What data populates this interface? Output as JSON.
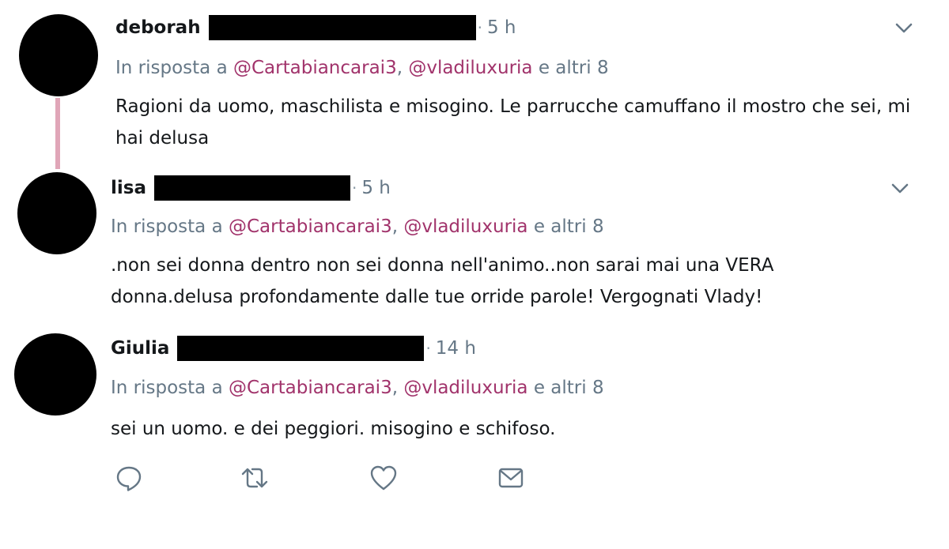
{
  "tweets": [
    {
      "username": "deborah",
      "time": "5 h",
      "reply_prefix": "In risposta a",
      "mention1": "@Cartabiancarai3",
      "separator": ",",
      "mention2": "@vladiluxuria",
      "reply_suffix": "e altri 8",
      "text": "Ragioni da uomo,  maschilista e misogino. Le parrucche camuffano il mostro che sei, mi hai delusa"
    },
    {
      "username": "lisa",
      "time": "5 h",
      "reply_prefix": "In risposta a",
      "mention1": "@Cartabiancarai3",
      "separator": ",",
      "mention2": "@vladiluxuria",
      "reply_suffix": "e altri 8",
      "text": ".non sei donna dentro non sei donna nell'animo..non sarai mai una VERA donna.delusa profondamente dalle tue orride parole! Vergognati Vlady!"
    },
    {
      "username": "Giulia",
      "time": "14 h",
      "reply_prefix": "In risposta a",
      "mention1": "@Cartabiancarai3",
      "separator": ",",
      "mention2": "@vladiluxuria",
      "reply_suffix": "e altri 8",
      "text": "sei un uomo. e dei peggiori. misogino e schifoso."
    }
  ],
  "dot_separator": "·",
  "icons": {
    "more": "chevron-down-icon",
    "reply": "reply-icon",
    "retweet": "retweet-icon",
    "like": "heart-icon",
    "message": "envelope-icon"
  },
  "colors": {
    "mention": "#a1336b",
    "thread_line": "#e0a6b8",
    "meta_text": "#657786",
    "icon": "#657786"
  }
}
